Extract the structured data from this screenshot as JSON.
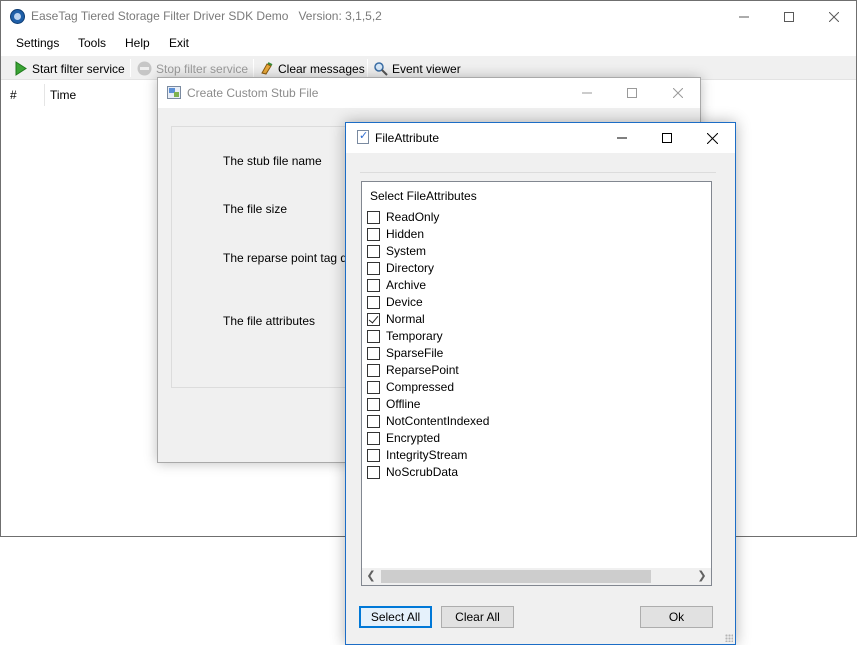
{
  "main": {
    "title": "EaseTag Tiered Storage Filter Driver SDK Demo",
    "version": "Version:  3,1,5,2",
    "menu": [
      "Settings",
      "Tools",
      "Help",
      "Exit"
    ],
    "toolbar": {
      "start": "Start filter service",
      "stop": "Stop filter service",
      "clear": "Clear messages",
      "events": "Event viewer"
    },
    "columns": [
      "#",
      "Time"
    ]
  },
  "stub_dialog": {
    "title": "Create Custom Stub File",
    "labels": {
      "name": "The stub file name",
      "size": "The file size",
      "reparse": "The reparse point tag data",
      "attributes": "The file attributes"
    }
  },
  "file_attribute": {
    "title": "FileAttribute",
    "caption": "Select FileAttributes",
    "items": [
      {
        "label": "ReadOnly",
        "checked": false
      },
      {
        "label": "Hidden",
        "checked": false
      },
      {
        "label": "System",
        "checked": false
      },
      {
        "label": "Directory",
        "checked": false
      },
      {
        "label": "Archive",
        "checked": false
      },
      {
        "label": "Device",
        "checked": false
      },
      {
        "label": "Normal",
        "checked": true
      },
      {
        "label": "Temporary",
        "checked": false
      },
      {
        "label": "SparseFile",
        "checked": false
      },
      {
        "label": "ReparsePoint",
        "checked": false
      },
      {
        "label": "Compressed",
        "checked": false
      },
      {
        "label": "Offline",
        "checked": false
      },
      {
        "label": "NotContentIndexed",
        "checked": false
      },
      {
        "label": "Encrypted",
        "checked": false
      },
      {
        "label": "IntegrityStream",
        "checked": false
      },
      {
        "label": "NoScrubData",
        "checked": false
      }
    ],
    "buttons": {
      "select_all": "Select All",
      "clear_all": "Clear All",
      "ok": "Ok"
    }
  }
}
